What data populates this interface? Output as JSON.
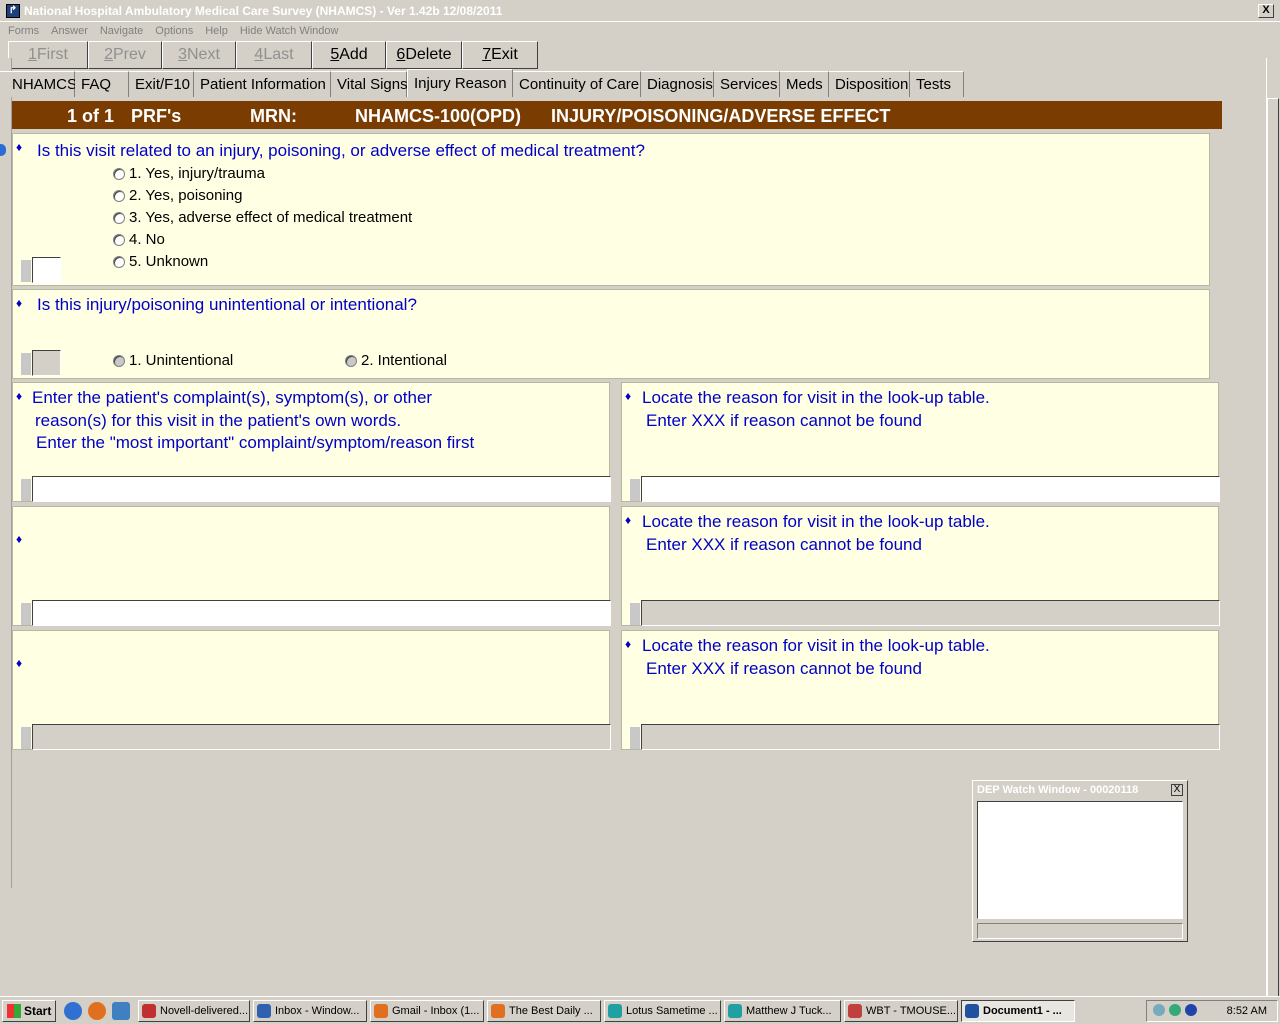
{
  "window": {
    "title": "National Hospital Ambulatory Medical Care Survey (NHAMCS) - Ver 1.42b 12/08/2011",
    "close": "X"
  },
  "menu": [
    "Forms",
    "Answer",
    "Navigate",
    "Options",
    "Help",
    "Hide Watch Window"
  ],
  "toolbar": [
    {
      "key": "1",
      "label": " First",
      "enabled": false
    },
    {
      "key": "2",
      "label": " Prev",
      "enabled": false
    },
    {
      "key": "3",
      "label": " Next",
      "enabled": false
    },
    {
      "key": "4",
      "label": " Last",
      "enabled": false
    },
    {
      "key": "5",
      "label": " Add",
      "enabled": true
    },
    {
      "key": "6",
      "label": " Delete",
      "enabled": true
    },
    {
      "key": "7",
      "label": " Exit",
      "enabled": true
    }
  ],
  "tabs": [
    {
      "label": "NHAMCS"
    },
    {
      "label": "FAQ"
    },
    {
      "label": "Exit/F10"
    },
    {
      "label": "Patient Information"
    },
    {
      "label": "Vital Signs"
    },
    {
      "label": "Injury Reason",
      "active": true
    },
    {
      "label": "Continuity of Care"
    },
    {
      "label": "Diagnosis"
    },
    {
      "label": "Services"
    },
    {
      "label": "Meds"
    },
    {
      "label": "Disposition"
    },
    {
      "label": "Tests"
    }
  ],
  "header": {
    "record": "1 of 1",
    "prf": "PRF's",
    "mrn": "MRN:",
    "form": "NHAMCS-100(OPD)",
    "section": "INJURY/POISONING/ADVERSE EFFECT"
  },
  "q1": {
    "bullet": "♦",
    "text": "Is this visit related to an injury, poisoning, or adverse effect of medical treatment?",
    "options": [
      "1.  Yes, injury/trauma",
      "2.  Yes, poisoning",
      "3.  Yes, adverse effect of medical treatment",
      "4.  No",
      "5.  Unknown"
    ],
    "value": ""
  },
  "q2": {
    "bullet": "♦",
    "text": "Is this injury/poisoning unintentional or intentional?",
    "options": [
      "1.  Unintentional",
      "2.  Intentional"
    ],
    "value": ""
  },
  "complaints": {
    "bullet": "♦",
    "line1": "Enter the patient's complaint(s), symptom(s), or other",
    "line2": "reason(s) for this visit in the patient's own words.",
    "line3": "Enter the \"most important\" complaint/symptom/reason first"
  },
  "lookup": {
    "bullet": "♦",
    "line1": "Locate the reason for visit in the look-up table.",
    "line2": "Enter XXX if reason cannot be found"
  },
  "watch": {
    "title": "DEP Watch Window - 00020118",
    "close": "X"
  },
  "taskbar": {
    "start": "Start",
    "items": [
      {
        "label": "Novell-delivered...",
        "color": "#c03030"
      },
      {
        "label": "Inbox - Window...",
        "color": "#3060b0"
      },
      {
        "label": "Gmail - Inbox (1...",
        "color": "#e07020"
      },
      {
        "label": "The Best Daily ...",
        "color": "#e07020"
      },
      {
        "label": "Lotus Sametime ...",
        "color": "#20a0a0"
      },
      {
        "label": "Matthew J Tuck...",
        "color": "#20a0a0"
      },
      {
        "label": "WBT - TMOUSE...",
        "color": "#c04040"
      },
      {
        "label": "Document1 - ...",
        "color": "#2050a0",
        "active": true
      }
    ],
    "clock": "8:52 AM"
  }
}
